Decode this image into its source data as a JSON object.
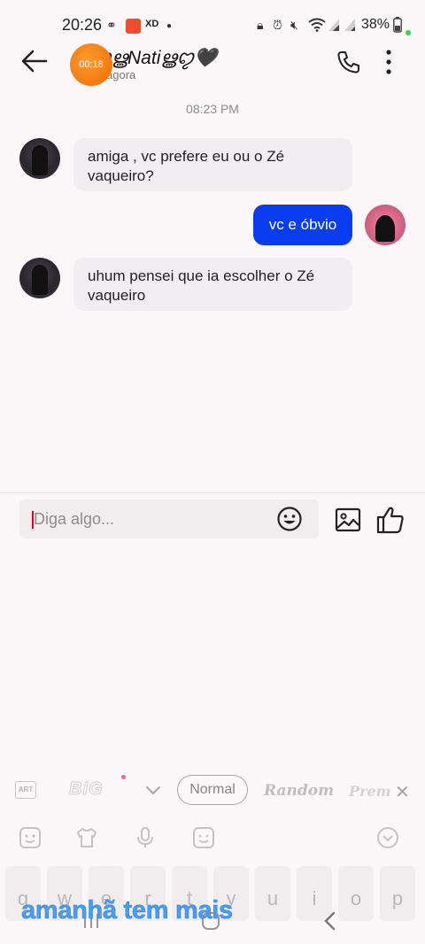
{
  "status_bar": {
    "time": "20:26",
    "carrier_tag": "XD",
    "battery": "38%"
  },
  "header": {
    "title": "🖤ꨄ︎ൠNatiൠꨄ︎🖤",
    "subtitle": "agora",
    "recording_timer": "00:18"
  },
  "chat": {
    "date": "08:23 PM",
    "messages": [
      {
        "from": "them",
        "text": "amiga , vc prefere eu ou o Zé vaqueiro?"
      },
      {
        "from": "me",
        "text": "vc e óbvio"
      },
      {
        "from": "them",
        "text": "uhum pensei que ia escolher o Zé vaqueiro"
      }
    ]
  },
  "composer": {
    "placeholder": "Diga algo..."
  },
  "keyboard": {
    "art_label": "ART",
    "big_label": "BIG",
    "normal_label": "Normal",
    "random_label": "Random",
    "prem_label": "Prem",
    "keys": [
      "q",
      "w",
      "e",
      "r",
      "t",
      "y",
      "u",
      "i",
      "o",
      "p"
    ]
  },
  "overlay_caption": "amanhã tem mais",
  "colors": {
    "outgoing_bubble": "#0a3df0",
    "incoming_bubble": "#f1edf0",
    "recording": "#f07a10",
    "caption": "#4a9cf0"
  }
}
